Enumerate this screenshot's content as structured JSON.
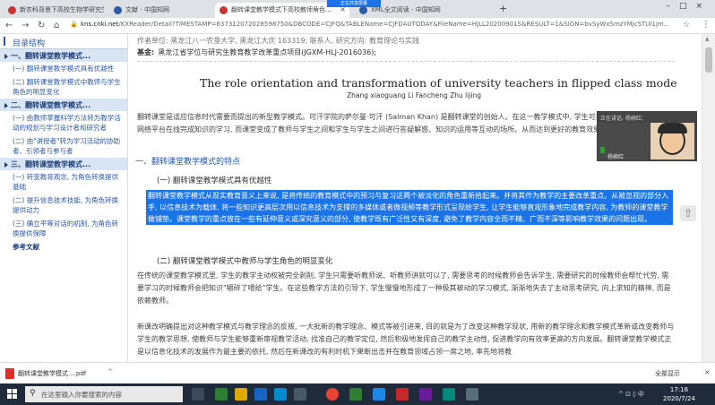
{
  "browser": {
    "tabs": [
      {
        "label": "新农科背景下高校生物学研究生..."
      },
      {
        "label": "文献 - 中国知网"
      },
      {
        "label": "翻转课堂教学模式下高校教师角色..."
      },
      {
        "label": "XML全文阅读 - 中国知网"
      }
    ],
    "rec_banner": "正在共享屏幕",
    "url_host": "kns.cnki.net",
    "url_path": "/KXReader/Detail?TIMESTAMP=637312072028598750&DBCODE=CJFQ&TABLEName=CJFDAUTODAY&FileName=HJLL20200901S&RESULT=1&SIGN=bvSyWxSmzYMjcSTUI1jm..."
  },
  "sidebar": {
    "title": "目录结构",
    "sections": [
      {
        "label": "一、翻转课堂教学模式...",
        "subs": [
          "(一) 翻转课堂教学模式具有优越性",
          "(二) 翻转课堂教学模式中教师与学生角色的明显变化"
        ]
      },
      {
        "label": "二、翻转课堂教学模式...",
        "subs": [
          "(一) 由教师掌握科学方法转为教学活动的规划与学习设计者和研究者",
          "(二) 由\"讲授者\"转为学习活动的协助者、引领者与参与者"
        ]
      },
      {
        "label": "三、翻转课堂教学模式...",
        "subs": [
          "(一) 转变教育观念, 为角色转换提供基础",
          "(二) 提升信息技术技能, 为角色转换提供动力",
          "(三) 确立平等对话的机制, 为角色转换提供保障"
        ]
      },
      {
        "label": "参考文献",
        "subs": []
      }
    ]
  },
  "article": {
    "topline": "作者单位: 黑龙江八一农垦大学, 黑龙江大庆 163319; 联系人, 研究方向: 教育理论与实践",
    "fund_label": "基金:",
    "fund_text": "黑龙江省学位与研究生教育教学改革重点项目(JGXM-HLJ-2016036);",
    "title_en": "The role orientation and transformation of university teachers in flipped class mode",
    "authors": "Zhang xiaoguang    Li Fancheng    Zhu lijing",
    "intro": "翻转课堂是适应信息时代需要而提出的新型教学模式。可汗学院的萨尔曼·可汗 (Salman Khan) 是翻转课堂的创始人。在这一教学模式中, 学生可通过网络平台在线完成知识的学习, 而课堂变成了教师与学生之间和学生与学生之间进行答疑解惑、知识的运用等互动的场所。从而达到更好的教育效果。",
    "heading1": "一、翻转课堂教学模式的特点",
    "heading2a": "(一) 翻转课堂教学模式具有优越性",
    "selected": "翻转课堂教学模式从现实教育意义上来说, 是将传统的教育模式中的预习与复习这两个被淡化的角色重新拾起来。并将其作为教学的主要改革重点。从被忽视的部分入手, 以信息技术为载体, 将一些知识更高层次用以信息技术为支撑的多媒体或者微视频等教学形式呈现给学生, 让学生能够直观形象地完成教学内容, 为教师的课堂教学做铺垫。课堂教学的重点放在一些有延伸意义或深究意义的部分, 使教学既有广泛性又有深度, 避免了教学内容全而不精、广而不深等影响教学效果的问题出现。",
    "heading2b": "(二) 翻转课堂教学模式中教师与学生角色的明显变化",
    "para2": "在传统的课堂教学模式里, 学生的教学主动权被完全剥削, 学生只需要听教师说、听教师讲就可以了, 需要思考的时候教师会告诉学生, 需要研究的时候教师会帮忙代劳, 需要学习的时候教师会把知识\"嚼碎了喂给\"学生。在这些教学方法的引导下, 学生慢慢地形成了一种极其被动的学习模式, 渐渐地失去了主动思考研究, 向上求知的精神, 而是依赖教师。",
    "para3": "新课改明确提出对这种教学模式与教学理念的反叛, 一大批新的教学理念、模式等被引进来, 目的就是为了改变这种教学现状, 用新的教学理念和教学模式革新或改变教师与学生的教学思想, 使教师与学生能够重新审视教学活动, 找准自己的教学定位, 然后积极地发挥自己的教学主动性, 促进教学向有效率更高的方向发展。翻转课堂教学模式正是以信息化技术的发展作为最主要的依托, 然后在新课改的有利时机下果断出击并在教育领域占领一席之地, 率先地将教"
  },
  "video": {
    "speaking": "正在讲话: 杨柳红;",
    "name": "杨柳红"
  },
  "downloads": {
    "item": "翻转课堂教学模式....pdf",
    "show_all": "全部显示"
  },
  "taskbar": {
    "search_placeholder": "在这里输入你要搜索的内容",
    "time": "17:16",
    "date": "2020/7/24",
    "lang": "中"
  }
}
